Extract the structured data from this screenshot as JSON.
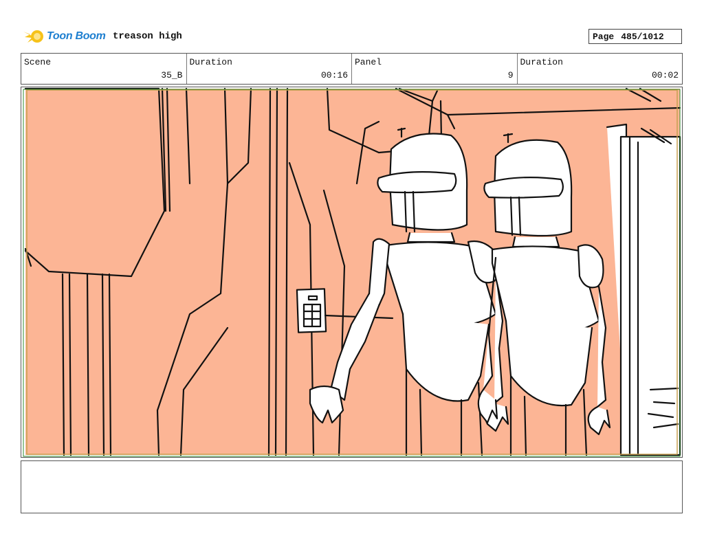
{
  "header": {
    "logo_text": "Toon Boom",
    "project_title": "treason high",
    "page_label": "Page",
    "page_number": "485/1012"
  },
  "info": {
    "scene_label": "Scene",
    "scene_value": "35_B",
    "scene_duration_label": "Duration",
    "scene_duration_value": "00:16",
    "panel_label": "Panel",
    "panel_value": "9",
    "panel_duration_label": "Duration",
    "panel_duration_value": "00:02"
  },
  "colors": {
    "wall_fill": "#fcb595",
    "line": "#111111",
    "logo_blue": "#1e7fd0",
    "logo_yellow": "#f6c21a",
    "safe_frame_green": "#2f8a2f"
  },
  "notes": {
    "text": ""
  }
}
